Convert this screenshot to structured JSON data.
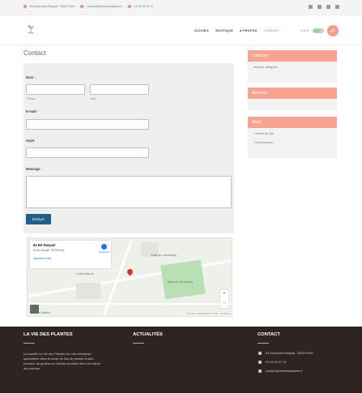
{
  "topbar": {
    "address": "84 Boulevard Raspail, 75006 Paris",
    "email": "contact@laviedesplantes.fr",
    "phone": "01 04 28 07 13",
    "social_icons": [
      "facebook-icon",
      "twitter-icon",
      "instagram-icon",
      "youtube-icon"
    ]
  },
  "header": {
    "nav": [
      "ACCUEIL",
      "BOUTIQUE",
      "À PROPOS",
      "CONTACT"
    ],
    "active_nav": "CONTACT",
    "cart_total": "0,00 €"
  },
  "page": {
    "title": "Contact"
  },
  "form": {
    "name_label": "Nom",
    "required_mark": "*",
    "first_name_sub": "Prénom",
    "last_name_sub": "Nom",
    "email_label": "E-mail",
    "subject_label": "Sujet",
    "message_label": "Message",
    "send_label": "Envoyer"
  },
  "map": {
    "place_name": "84 Bd Raspail",
    "place_address": "84 Bd Raspail, 75006 Paris",
    "larger_map_link": "Agrandir le plan",
    "directions_label": "Itinéraires",
    "labels": [
      "Palais du Luxembourg",
      "Jardin du Luxembourg",
      "Musée Zadkine",
      "Le Bon Marché"
    ],
    "zoom_in": "+",
    "zoom_out": "−",
    "credit": "Données cartographiques ©2023 · Conditions"
  },
  "sidebar": {
    "category": {
      "title": "Category",
      "items": [
        "Aucune catégorie"
      ]
    },
    "archives": {
      "title": "Archives"
    },
    "meta": {
      "title": "Meta",
      "items": [
        "Admin du site",
        "Déconnexion"
      ]
    }
  },
  "footer": {
    "col1": {
      "title": "LA VIE DES PLANTES",
      "text": "La société La Vie des Plantes est une entreprise spécialisée dans la vente de kits de plantes à faire pousser, de graines et d'autres produits liés à la culture des plantes."
    },
    "col2": {
      "title": "ACTUALITÉS"
    },
    "col3": {
      "title": "CONTACT",
      "address": "84 Boulevard Raspail, 75006 Paris",
      "phone": "01 04 28 07 13",
      "email": "contact@laviedesplantes.fr"
    }
  },
  "colors": {
    "accent": "#f6a491",
    "button": "#1f5e86",
    "footer_bg": "#2e2422"
  }
}
